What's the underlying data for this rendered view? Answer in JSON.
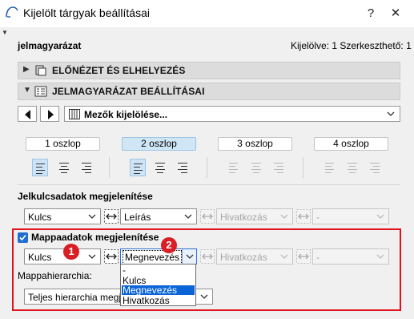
{
  "window": {
    "title": "Kijelölt tárgyak beállításai",
    "help_label": "?",
    "close_label": "✕"
  },
  "header": {
    "element_name": "jelmagyarázat",
    "selection_info": "Kijelölve: 1 Szerkeszthető: 1"
  },
  "sections": {
    "preview": "ELŐNÉZET ÉS ELHELYEZÉS",
    "legend_settings": "JELMAGYARÁZAT BEÁLLÍTÁSAI"
  },
  "fields_button": "Mezők kijelölése...",
  "columns": [
    "1 oszlop",
    "2 oszlop",
    "3 oszlop",
    "4 oszlop"
  ],
  "active_column": "2 oszlop",
  "key_display": {
    "heading": "Jelkulcsadatok megjelenítése",
    "combo1": "Kulcs",
    "combo2": "Leírás",
    "combo3": "Hivatkozás",
    "combo4": "-"
  },
  "folder_display": {
    "checkbox_label": "Mappaadatok megjelenítése",
    "checked": true,
    "combo1": "Kulcs",
    "combo2": "Megnevezés",
    "combo3": "Hivatkozás",
    "combo4": "-",
    "hierarchy_label": "Mappahierarchia:",
    "hierarchy_value": "Teljes hierarchia megje"
  },
  "dropdown_options": [
    "-",
    "Kulcs",
    "Megnevezés",
    "Hivatkozás"
  ],
  "dropdown_selected": "Megnevezés",
  "badges": [
    "1",
    "2"
  ],
  "colors": {
    "accent": "#1f6fd0",
    "highlight_border": "#e0141e",
    "badge": "#d81f26",
    "selection": "#0a64d8"
  }
}
